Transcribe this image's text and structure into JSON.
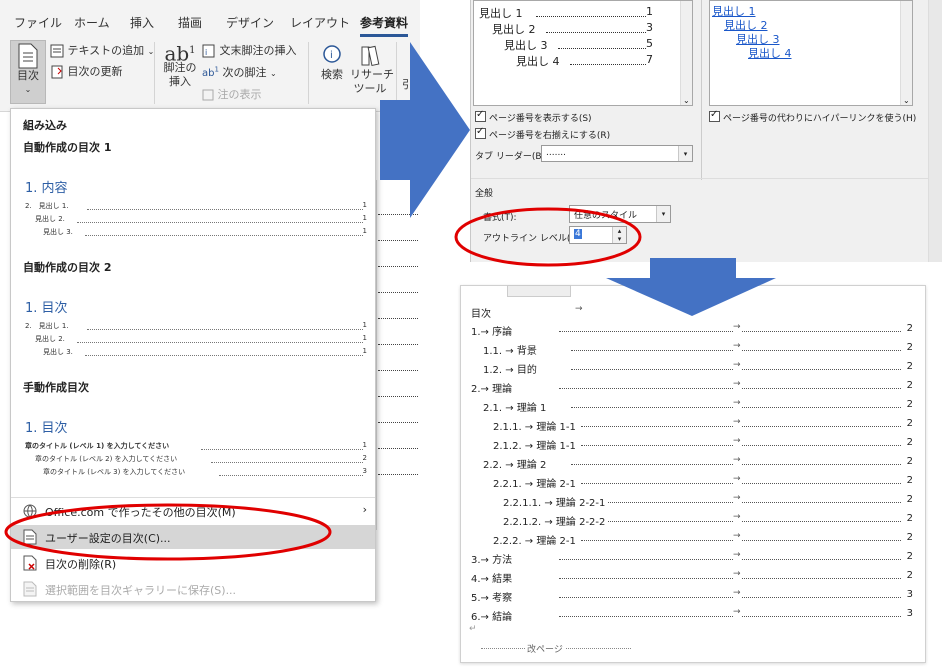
{
  "ribbon": {
    "tabs": [
      "ファイル",
      "ホーム",
      "挿入",
      "描画",
      "デザイン",
      "レイアウト",
      "参考資料"
    ],
    "toc_button": "目次",
    "add_text": "テキストの追加",
    "update_toc": "目次の更新",
    "footnote_l1": "脚注の",
    "footnote_l2": "挿入",
    "endnote": "文末脚注の挿入",
    "next_footnote": "次の脚注",
    "show_notes": "注の表示",
    "search": "検索",
    "research_l1": "リサーチ",
    "research_l2": "ツール",
    "cite": "引用"
  },
  "menu": {
    "builtin": "組み込み",
    "auto1": "自動作成の目次 1",
    "auto1_title": "1. 内容",
    "auto1_lines": [
      [
        "2.　見出し 1.",
        "1"
      ],
      [
        "見出し 2.",
        "1"
      ],
      [
        "見出し 3.",
        "1"
      ]
    ],
    "auto2": "自動作成の目次 2",
    "auto2_title": "1. 目次",
    "auto2_lines": [
      [
        "2.　見出し 1.",
        "1"
      ],
      [
        "見出し 2.",
        "1"
      ],
      [
        "見出し 3.",
        "1"
      ]
    ],
    "manual": "手動作成目次",
    "manual_title": "1. 目次",
    "manual_lines": [
      [
        "章のタイトル (レベル 1) を入力してください",
        "1"
      ],
      [
        "章のタイトル (レベル 2) を入力してください",
        "2"
      ],
      [
        "章のタイトル (レベル 3) を入力してください",
        "3"
      ]
    ],
    "office_more": "Office.com で作ったその他の目次(M)",
    "custom_toc": "ユーザー設定の目次(C)...",
    "delete_toc": "目次の削除(R)",
    "save_selection": "選択範囲を目次ギャラリーに保存(S)..."
  },
  "dialog": {
    "print_preview": [
      [
        "見出し 1",
        "1"
      ],
      [
        "見出し 2",
        "3"
      ],
      [
        "見出し 3",
        "5"
      ],
      [
        "見出し 4",
        "7"
      ]
    ],
    "web_preview": [
      "見出し 1",
      "見出し 2",
      "見出し 3",
      "見出し 4"
    ],
    "show_page_numbers": "ページ番号を表示する(S)",
    "right_align": "ページ番号を右揃えにする(R)",
    "use_hyperlinks": "ページ番号の代わりにハイパーリンクを使う(H)",
    "tab_leader_label": "タブ リーダー(B):",
    "tab_leader_value": ".......",
    "general": "全般",
    "format_label": "書式(T):",
    "format_value": "任意のスタイル",
    "outline_label": "アウトライン レベル(L):",
    "outline_value": "4"
  },
  "document": {
    "header": "目次",
    "entries": [
      {
        "text": "1.→ 序論",
        "page": "2"
      },
      {
        "text": "1.1. → 背景",
        "page": "2"
      },
      {
        "text": "1.2. → 目的",
        "page": "2"
      },
      {
        "text": "2.→ 理論",
        "page": "2"
      },
      {
        "text": "2.1. → 理論 1",
        "page": "2"
      },
      {
        "text": "2.1.1. → 理論 1-1",
        "page": "2"
      },
      {
        "text": "2.1.2. → 理論 1-1",
        "page": "2"
      },
      {
        "text": "2.2. → 理論 2",
        "page": "2"
      },
      {
        "text": "2.2.1. → 理論 2-1",
        "page": "2"
      },
      {
        "text": "2.2.1.1. → 理論 2-2-1",
        "page": "2"
      },
      {
        "text": "2.2.1.2. → 理論 2-2-2",
        "page": "2"
      },
      {
        "text": "2.2.2. → 理論 2-1",
        "page": "2"
      },
      {
        "text": "3.→ 方法",
        "page": "2"
      },
      {
        "text": "4.→ 結果",
        "page": "2"
      },
      {
        "text": "5.→ 考察",
        "page": "3"
      },
      {
        "text": "6.→ 結論",
        "page": "3"
      }
    ],
    "page_break": "改ページ"
  },
  "colors": {
    "accent": "#2b5797",
    "arrow": "#4472c4",
    "highlight": "#e00000"
  }
}
